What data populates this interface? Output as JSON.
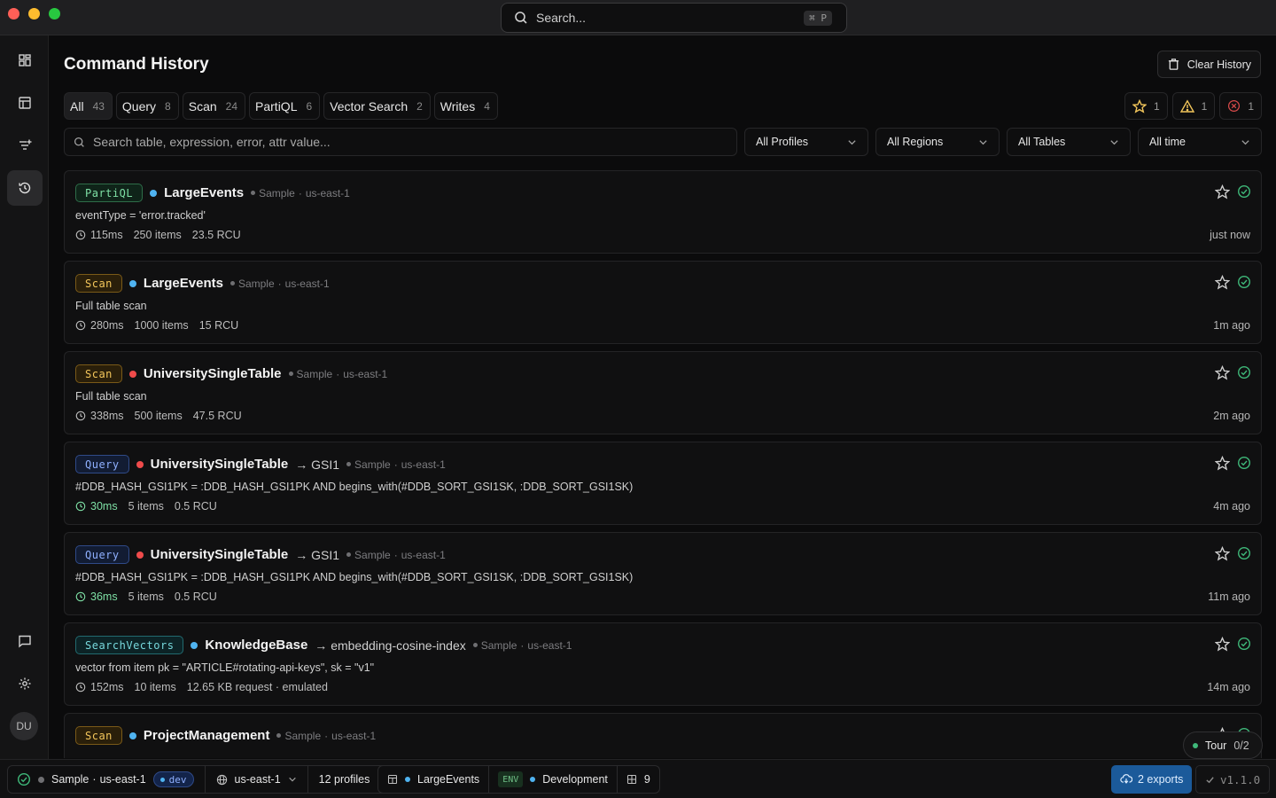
{
  "titlebar": {
    "search_placeholder": "Search...",
    "shortcut": "⌘ P"
  },
  "rail": {
    "items": [
      {
        "icon": "dashboard-icon"
      },
      {
        "icon": "table-icon"
      },
      {
        "icon": "filter-add-icon"
      },
      {
        "icon": "history-icon",
        "active": true
      }
    ],
    "bottom": [
      {
        "icon": "chat-icon"
      },
      {
        "icon": "gear-icon"
      }
    ],
    "avatar": "DU"
  },
  "page": {
    "title": "Command History",
    "clear_label": "Clear History"
  },
  "tabs": [
    {
      "label": "All",
      "count": "43",
      "active": true
    },
    {
      "label": "Query",
      "count": "8"
    },
    {
      "label": "Scan",
      "count": "24"
    },
    {
      "label": "PartiQL",
      "count": "6"
    },
    {
      "label": "Vector Search",
      "count": "2"
    },
    {
      "label": "Writes",
      "count": "4"
    }
  ],
  "counters": {
    "starred": "1",
    "warnings": "1",
    "errors": "1"
  },
  "filters": {
    "search_placeholder": "Search table, expression, error, attr value...",
    "profiles": "All Profiles",
    "regions": "All Regions",
    "tables": "All Tables",
    "time": "All time"
  },
  "colors": {
    "dot_blue": "#4fb3f0",
    "dot_red": "#ef4b4b",
    "success": "#3fb97a",
    "accent": "#1b5a9a"
  },
  "history": [
    {
      "type": "PartiQL",
      "dot": "blue",
      "table": "LargeEvents",
      "index": "",
      "profile": "Sample",
      "region": "us-east-1",
      "expr": "eventType = 'error.tracked'",
      "duration": "115ms",
      "items": "250 items",
      "cost": "23.5 RCU",
      "extra": "",
      "when": "just now"
    },
    {
      "type": "Scan",
      "dot": "blue",
      "table": "LargeEvents",
      "index": "",
      "profile": "Sample",
      "region": "us-east-1",
      "expr": "Full table scan",
      "duration": "280ms",
      "items": "1000 items",
      "cost": "15 RCU",
      "extra": "",
      "when": "1m ago"
    },
    {
      "type": "Scan",
      "dot": "red",
      "table": "UniversitySingleTable",
      "index": "",
      "profile": "Sample",
      "region": "us-east-1",
      "expr": "Full table scan",
      "duration": "338ms",
      "items": "500 items",
      "cost": "47.5 RCU",
      "extra": "",
      "when": "2m ago"
    },
    {
      "type": "Query",
      "dot": "red",
      "table": "UniversitySingleTable",
      "index": "GSI1",
      "profile": "Sample",
      "region": "us-east-1",
      "expr": "#DDB_HASH_GSI1PK = :DDB_HASH_GSI1PK AND begins_with(#DDB_SORT_GSI1SK, :DDB_SORT_GSI1SK)",
      "duration": "30ms",
      "fast": true,
      "items": "5 items",
      "cost": "0.5 RCU",
      "extra": "",
      "when": "4m ago"
    },
    {
      "type": "Query",
      "dot": "red",
      "table": "UniversitySingleTable",
      "index": "GSI1",
      "profile": "Sample",
      "region": "us-east-1",
      "expr": "#DDB_HASH_GSI1PK = :DDB_HASH_GSI1PK AND begins_with(#DDB_SORT_GSI1SK, :DDB_SORT_GSI1SK)",
      "duration": "36ms",
      "fast": true,
      "items": "5 items",
      "cost": "0.5 RCU",
      "extra": "",
      "when": "11m ago"
    },
    {
      "type": "SearchVectors",
      "dot": "blue",
      "table": "KnowledgeBase",
      "index": "embedding-cosine-index",
      "profile": "Sample",
      "region": "us-east-1",
      "expr": "vector from item pk = \"ARTICLE#rotating-api-keys\", sk = \"v1\"",
      "duration": "152ms",
      "items": "10 items",
      "cost": "12.65 KB request",
      "extra": "emulated",
      "when": "14m ago"
    },
    {
      "type": "Scan",
      "dot": "blue",
      "table": "ProjectManagement",
      "index": "",
      "profile": "Sample",
      "region": "us-east-1",
      "expr": "",
      "duration": "",
      "items": "",
      "cost": "",
      "extra": "",
      "when": ""
    }
  ],
  "tour": {
    "label": "Tour",
    "progress": "0/2"
  },
  "statusbar": {
    "profile": "Sample",
    "region": "us-east-1",
    "env_badge": "dev",
    "region_select": "us-east-1",
    "profiles": "12 profiles",
    "table": "LargeEvents",
    "env_tag": "ENV",
    "environment": "Development",
    "tables_count": "9",
    "exports": "2 exports",
    "version": "v1.1.0"
  }
}
